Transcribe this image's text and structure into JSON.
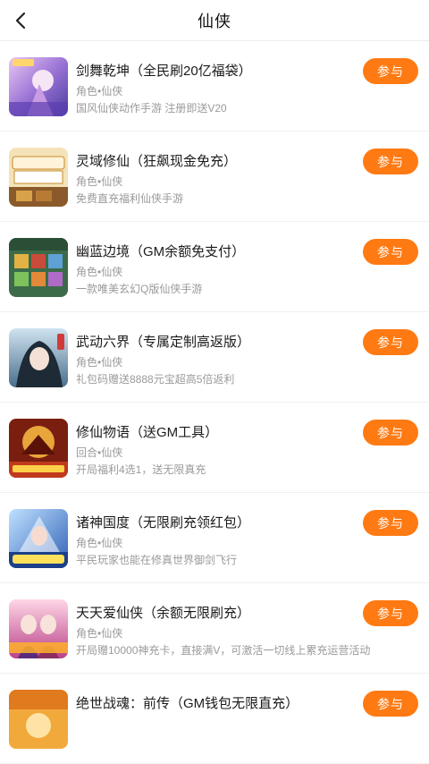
{
  "header": {
    "title": "仙侠"
  },
  "icons": {
    "back": "chevron-left-icon"
  },
  "accent": "#ff7a12",
  "join_label": "参与",
  "games": [
    {
      "name": "剑舞乾坤（全民刷20亿福袋）",
      "tag": "角色•仙侠",
      "desc": "国风仙侠动作手游 注册即送V20"
    },
    {
      "name": "灵域修仙（狂飙现金免充）",
      "tag": "角色•仙侠",
      "desc": "免费直充福利仙侠手游"
    },
    {
      "name": "幽蓝边境（GM余额免支付）",
      "tag": "角色•仙侠",
      "desc": "一款唯美玄幻Q版仙侠手游"
    },
    {
      "name": "武动六界（专属定制高返版）",
      "tag": "角色•仙侠",
      "desc": "礼包码赠送8888元宝超高5倍返利"
    },
    {
      "name": "修仙物语（送GM工具）",
      "tag": "回合•仙侠",
      "desc": "开局福利4选1，送无限真充"
    },
    {
      "name": "诸神国度（无限刷充领红包）",
      "tag": "角色•仙侠",
      "desc": "平民玩家也能在修真世界御剑飞行"
    },
    {
      "name": "天天爱仙侠（余额无限刷充）",
      "tag": "角色•仙侠",
      "desc": "开局赠10000神充卡，直接满V，可激活一切线上累充运营活动"
    },
    {
      "name": "绝世战魂：前传（GM钱包无限直充）",
      "tag": "",
      "desc": ""
    }
  ]
}
